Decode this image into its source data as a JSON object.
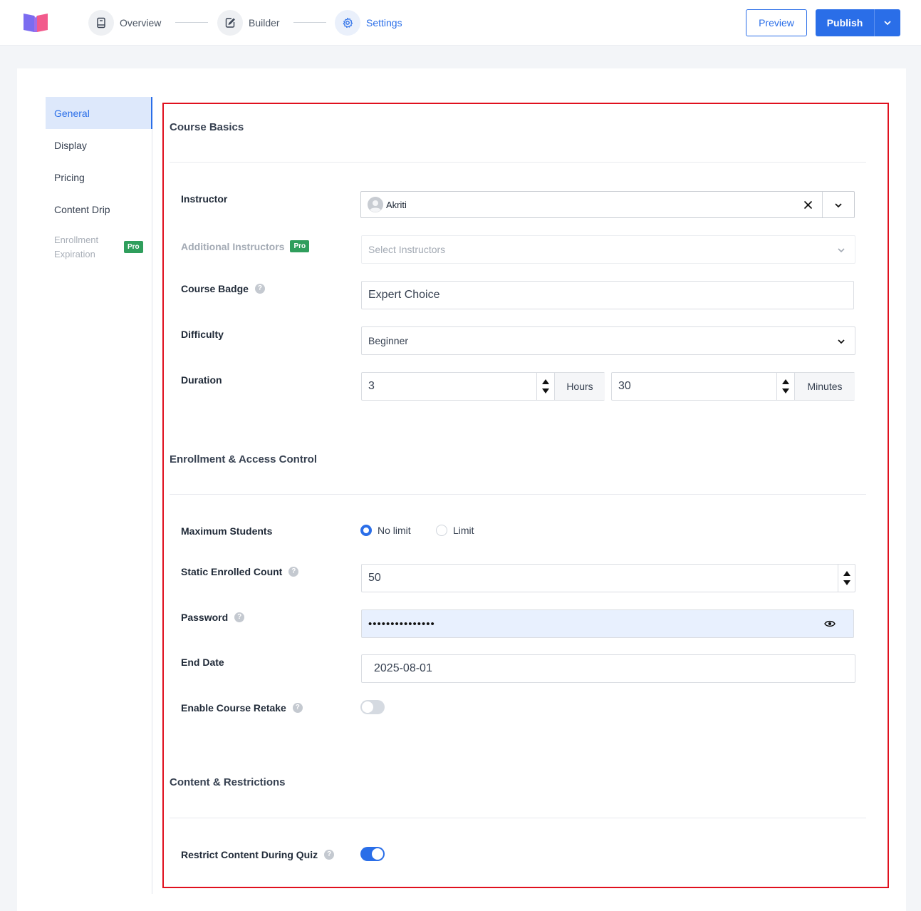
{
  "header": {
    "steps": [
      {
        "label": "Overview",
        "icon": "book-icon"
      },
      {
        "label": "Builder",
        "icon": "edit-icon"
      },
      {
        "label": "Settings",
        "icon": "gear-icon"
      }
    ],
    "preview_label": "Preview",
    "publish_label": "Publish",
    "accent": "#2a6ee8"
  },
  "sidebar": {
    "items": [
      {
        "label": "General"
      },
      {
        "label": "Display"
      },
      {
        "label": "Pricing"
      },
      {
        "label": "Content Drip"
      },
      {
        "label_line1": "Enrollment",
        "label_line2": "Expiration",
        "badge": "Pro"
      }
    ]
  },
  "course_basics": {
    "title": "Course Basics",
    "instructor": {
      "label": "Instructor",
      "value": "Akriti"
    },
    "additional_instructors": {
      "label": "Additional Instructors",
      "badge": "Pro",
      "placeholder": "Select Instructors"
    },
    "course_badge": {
      "label": "Course Badge",
      "value": "Expert Choice"
    },
    "difficulty": {
      "label": "Difficulty",
      "value": "Beginner"
    },
    "duration": {
      "label": "Duration",
      "hours_value": "3",
      "hours_unit": "Hours",
      "minutes_value": "30",
      "minutes_unit": "Minutes"
    }
  },
  "enrollment": {
    "title": "Enrollment & Access Control",
    "max_students": {
      "label": "Maximum Students",
      "options": [
        "No limit",
        "Limit"
      ],
      "selected": "No limit"
    },
    "static_enrolled": {
      "label": "Static Enrolled Count",
      "value": "50"
    },
    "password": {
      "label": "Password",
      "masked": "•••••••••••••••"
    },
    "end_date": {
      "label": "End Date",
      "value": "2025-08-01"
    },
    "retake": {
      "label": "Enable Course Retake",
      "enabled": false
    }
  },
  "content": {
    "title": "Content & Restrictions",
    "restrict_quiz": {
      "label": "Restrict Content During Quiz",
      "enabled": true
    }
  }
}
